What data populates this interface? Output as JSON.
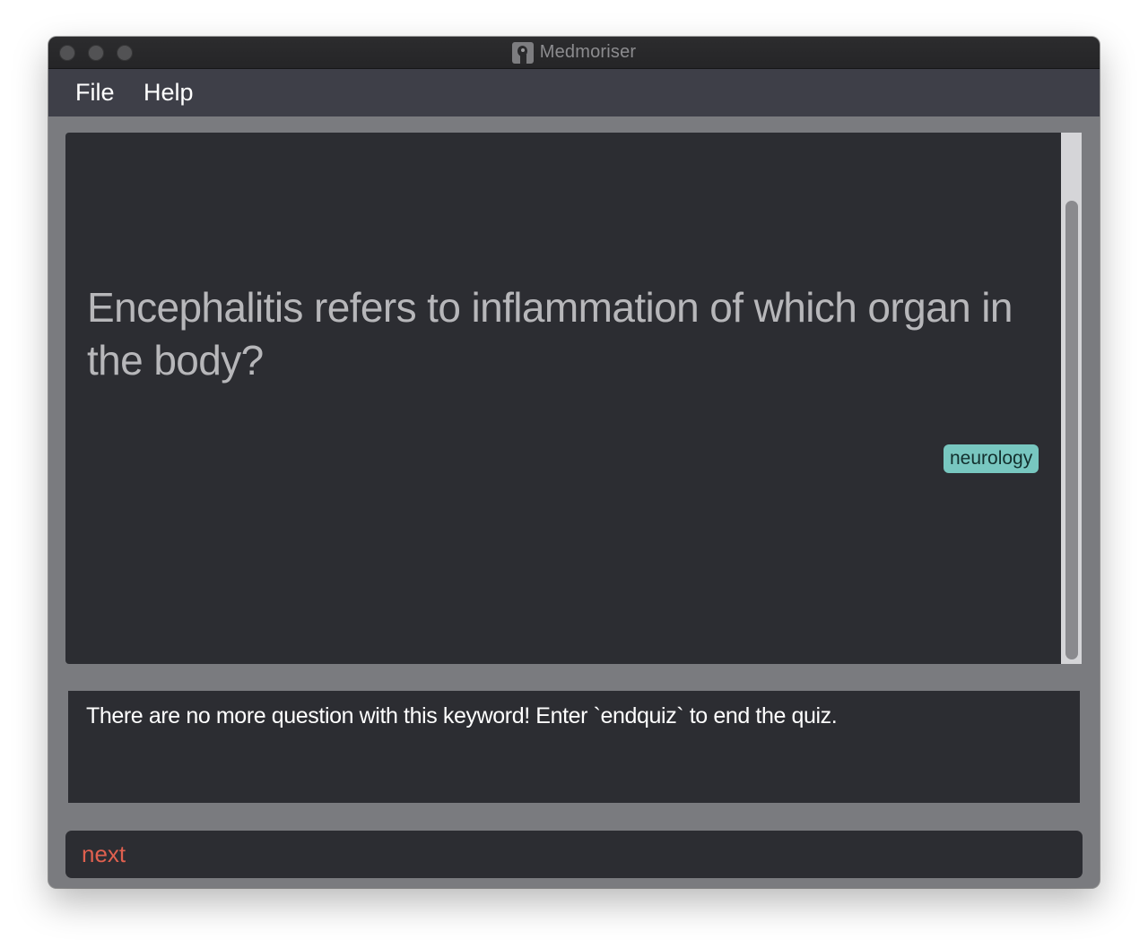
{
  "window": {
    "title": "Medmoriser",
    "app_icon": "brain-head-icon"
  },
  "menubar": {
    "items": [
      {
        "label": "File"
      },
      {
        "label": "Help"
      }
    ]
  },
  "question_card": {
    "question": "Encephalitis refers to inflammation of which organ in the body?",
    "tag": "neurology",
    "tag_color": "#78c7c0"
  },
  "result_display": {
    "message": "There are no more question with this keyword! Enter `endquiz` to end the quiz."
  },
  "command_box": {
    "value": "next",
    "text_color": "#e0604f"
  },
  "colors": {
    "panel_background": "#2c2d32",
    "window_background": "#7a7b7f",
    "menubar_background": "#3e3f48"
  }
}
